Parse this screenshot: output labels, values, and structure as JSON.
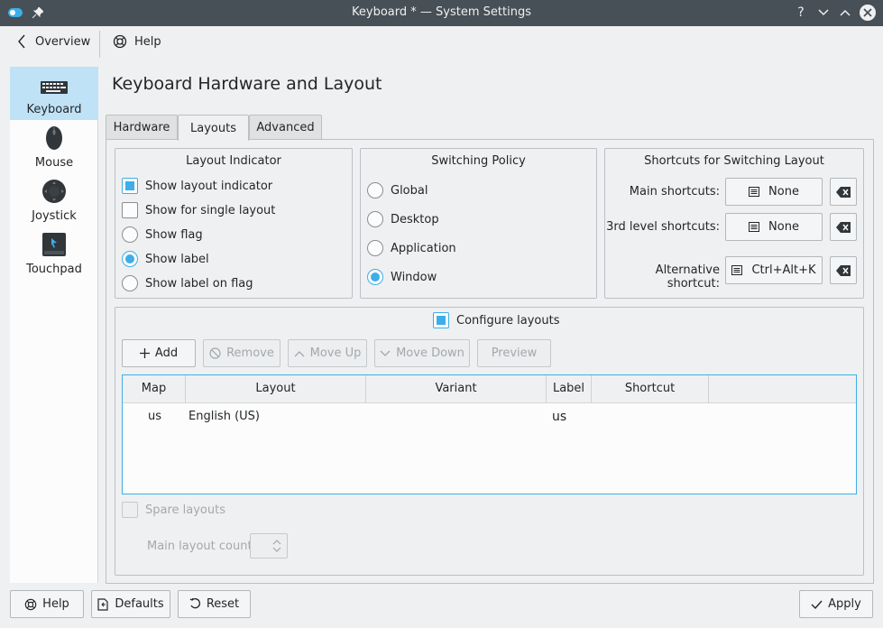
{
  "window": {
    "title": "Keyboard * — System Settings"
  },
  "toolbar": {
    "overview": "Overview",
    "help": "Help"
  },
  "sidebar": {
    "items": [
      {
        "label": "Keyboard",
        "icon": "keyboard-icon"
      },
      {
        "label": "Mouse",
        "icon": "mouse-icon"
      },
      {
        "label": "Joystick",
        "icon": "joystick-icon"
      },
      {
        "label": "Touchpad",
        "icon": "touchpad-icon"
      }
    ]
  },
  "page": {
    "title": "Keyboard Hardware and Layout"
  },
  "tabs": [
    {
      "label": "Hardware"
    },
    {
      "label": "Layouts"
    },
    {
      "label": "Advanced"
    }
  ],
  "layout_indicator": {
    "title": "Layout Indicator",
    "show_indicator": "Show layout indicator",
    "show_single": "Show for single layout",
    "show_flag": "Show flag",
    "show_label": "Show label",
    "show_label_on_flag": "Show label on flag"
  },
  "switching_policy": {
    "title": "Switching Policy",
    "options": [
      "Global",
      "Desktop",
      "Application",
      "Window"
    ]
  },
  "shortcuts": {
    "title": "Shortcuts for Switching Layout",
    "main_label": "Main shortcuts:",
    "main_value": "None",
    "third_label": "3rd level shortcuts:",
    "third_value": "None",
    "alt_label": "Alternative shortcut:",
    "alt_value": "Ctrl+Alt+K"
  },
  "configure": {
    "label": "Configure layouts",
    "add": "Add",
    "remove": "Remove",
    "move_up": "Move Up",
    "move_down": "Move Down",
    "preview": "Preview"
  },
  "table": {
    "headers": [
      "Map",
      "Layout",
      "Variant",
      "Label",
      "Shortcut"
    ],
    "rows": [
      {
        "map": "us",
        "layout": "English (US)",
        "variant": "",
        "label": "us",
        "shortcut": ""
      }
    ]
  },
  "spare": {
    "label": "Spare layouts",
    "count_label": "Main layout count:"
  },
  "bottom": {
    "help": "Help",
    "defaults": "Defaults",
    "reset": "Reset",
    "apply": "Apply"
  },
  "colors": {
    "accent": "#3daee9",
    "titlebar": "#475057",
    "selected": "#bfe2f6"
  }
}
